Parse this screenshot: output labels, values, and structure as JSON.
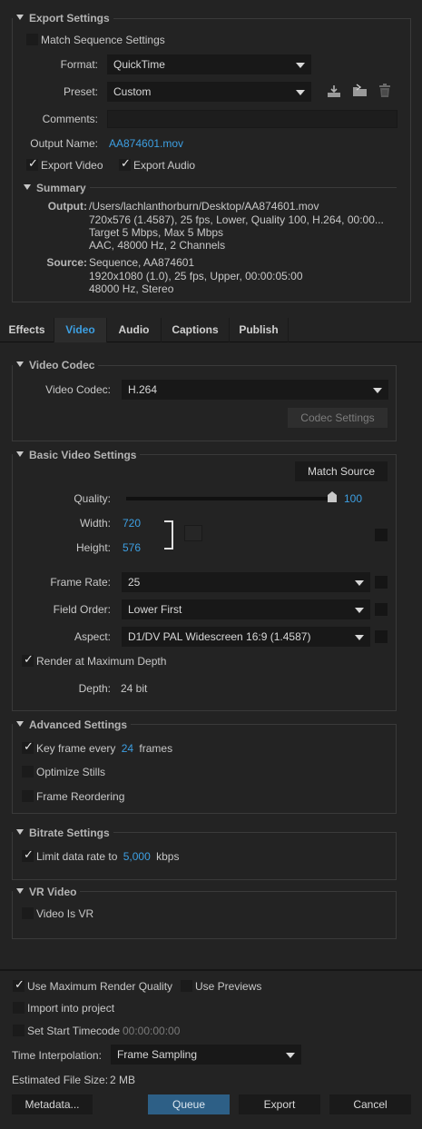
{
  "export_settings": {
    "header": "Export Settings",
    "match_sequence_label": "Match Sequence Settings",
    "match_sequence_checked": false,
    "format_label": "Format:",
    "format_value": "QuickTime",
    "preset_label": "Preset:",
    "preset_value": "Custom",
    "comments_label": "Comments:",
    "comments_value": "",
    "output_name_label": "Output Name:",
    "output_name_value": "AA874601.mov",
    "export_video_label": "Export Video",
    "export_video_checked": true,
    "export_audio_label": "Export Audio",
    "export_audio_checked": true,
    "summary": {
      "header": "Summary",
      "output_label": "Output:",
      "output_lines": [
        "/Users/lachlanthorburn/Desktop/AA874601.mov",
        "720x576 (1.4587), 25 fps, Lower, Quality 100, H.264, 00:00...",
        "Target 5 Mbps, Max 5 Mbps",
        "AAC, 48000 Hz, 2 Channels"
      ],
      "source_label": "Source:",
      "source_lines": [
        "Sequence, AA874601",
        "1920x1080 (1.0), 25 fps, Upper, 00:00:05:00",
        "48000 Hz, Stereo"
      ]
    }
  },
  "tabs": [
    {
      "label": "Effects",
      "active": false
    },
    {
      "label": "Video",
      "active": true
    },
    {
      "label": "Audio",
      "active": false
    },
    {
      "label": "Captions",
      "active": false
    },
    {
      "label": "Publish",
      "active": false
    }
  ],
  "video_codec": {
    "header": "Video Codec",
    "codec_label": "Video Codec:",
    "codec_value": "H.264",
    "codec_settings_button": "Codec Settings"
  },
  "basic_video": {
    "header": "Basic Video Settings",
    "match_source_button": "Match Source",
    "quality_label": "Quality:",
    "quality_value": "100",
    "quality_fraction": 1.0,
    "width_label": "Width:",
    "width_value": "720",
    "height_label": "Height:",
    "height_value": "576",
    "frame_rate_label": "Frame Rate:",
    "frame_rate_value": "25",
    "field_order_label": "Field Order:",
    "field_order_value": "Lower First",
    "aspect_label": "Aspect:",
    "aspect_value": "D1/DV PAL Widescreen 16:9 (1.4587)",
    "render_max_depth_label": "Render at Maximum Depth",
    "render_max_depth_checked": true,
    "depth_label": "Depth:",
    "depth_value": "24 bit"
  },
  "advanced": {
    "header": "Advanced Settings",
    "key_frame_prefix": "Key frame every",
    "key_frame_value": "24",
    "key_frame_suffix": "frames",
    "key_frame_checked": true,
    "optimize_stills_label": "Optimize Stills",
    "optimize_stills_checked": false,
    "frame_reordering_label": "Frame Reordering",
    "frame_reordering_checked": false
  },
  "bitrate": {
    "header": "Bitrate Settings",
    "limit_prefix": "Limit data rate to",
    "limit_value": "5,000",
    "limit_unit": "kbps",
    "limit_checked": true
  },
  "vr": {
    "header": "VR Video",
    "video_is_vr_label": "Video Is VR",
    "video_is_vr_checked": false
  },
  "bottom": {
    "max_render_quality_label": "Use Maximum Render Quality",
    "max_render_quality_checked": true,
    "use_previews_label": "Use Previews",
    "use_previews_checked": false,
    "import_project_label": "Import into project",
    "import_project_checked": false,
    "start_timecode_label": "Set Start Timecode",
    "start_timecode_checked": false,
    "start_timecode_value": "00:00:00:00",
    "time_interp_label": "Time Interpolation:",
    "time_interp_value": "Frame Sampling",
    "file_size_label": "Estimated File Size:",
    "file_size_value": "2 MB",
    "metadata_button": "Metadata...",
    "queue_button": "Queue",
    "export_button": "Export",
    "cancel_button": "Cancel"
  },
  "icons": [
    "save-preset-icon",
    "import-preset-icon",
    "delete-preset-icon",
    "chain-link-icon",
    "collapse-triangle-icon",
    "dropdown-arrow-icon",
    "checkmark-icon"
  ],
  "colors": {
    "accent": "#3d9fe2",
    "background": "#232323",
    "field": "#181818",
    "queue": "#2d5f86"
  }
}
